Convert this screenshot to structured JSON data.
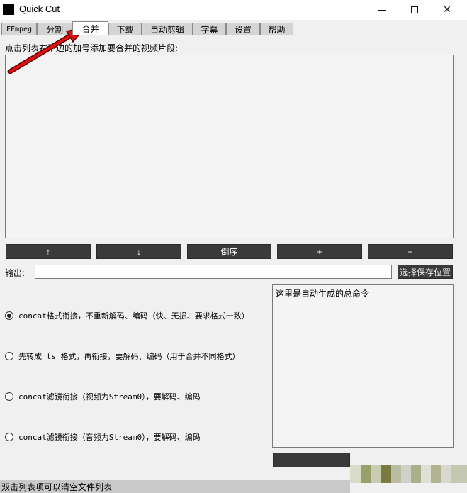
{
  "window": {
    "title": "Quick Cut",
    "minimize_icon": "minimize-icon",
    "maximize_icon": "maximize-icon",
    "close_symbol": "✕"
  },
  "tabs": [
    {
      "label": "FFmpeg"
    },
    {
      "label": "分割"
    },
    {
      "label": "合并",
      "active": true
    },
    {
      "label": "下载"
    },
    {
      "label": "自动剪辑"
    },
    {
      "label": "字幕"
    },
    {
      "label": "设置"
    },
    {
      "label": "帮助"
    }
  ],
  "merge": {
    "hint": "点击列表右下边的加号添加要合并的视频片段:",
    "buttons": {
      "up": "↑",
      "down": "↓",
      "reverse": "倒序",
      "add": "+",
      "remove": "−"
    },
    "output_label": "输出:",
    "output_value": "",
    "choose_save_button": "选择保存位置",
    "options": [
      {
        "label": "concat格式衔接，不重新解码、编码（快、无损、要求格式一致）",
        "checked": true
      },
      {
        "label": "先转成 ts 格式，再衔接，要解码、编码（用于合并不同格式）",
        "checked": false
      },
      {
        "label": "concat滤镜衔接（视频为Stream0），要解码、编码",
        "checked": false
      },
      {
        "label": "concat滤镜衔接（音频为Stream0），要解码、编码",
        "checked": false
      }
    ],
    "command_text": "这里是自动生成的总命令",
    "run_button": ""
  },
  "status": {
    "text": "双击列表项可以清空文件列表"
  },
  "colors": {
    "button_dark": "#3a3a3a",
    "arrow_red": "#e01010"
  }
}
